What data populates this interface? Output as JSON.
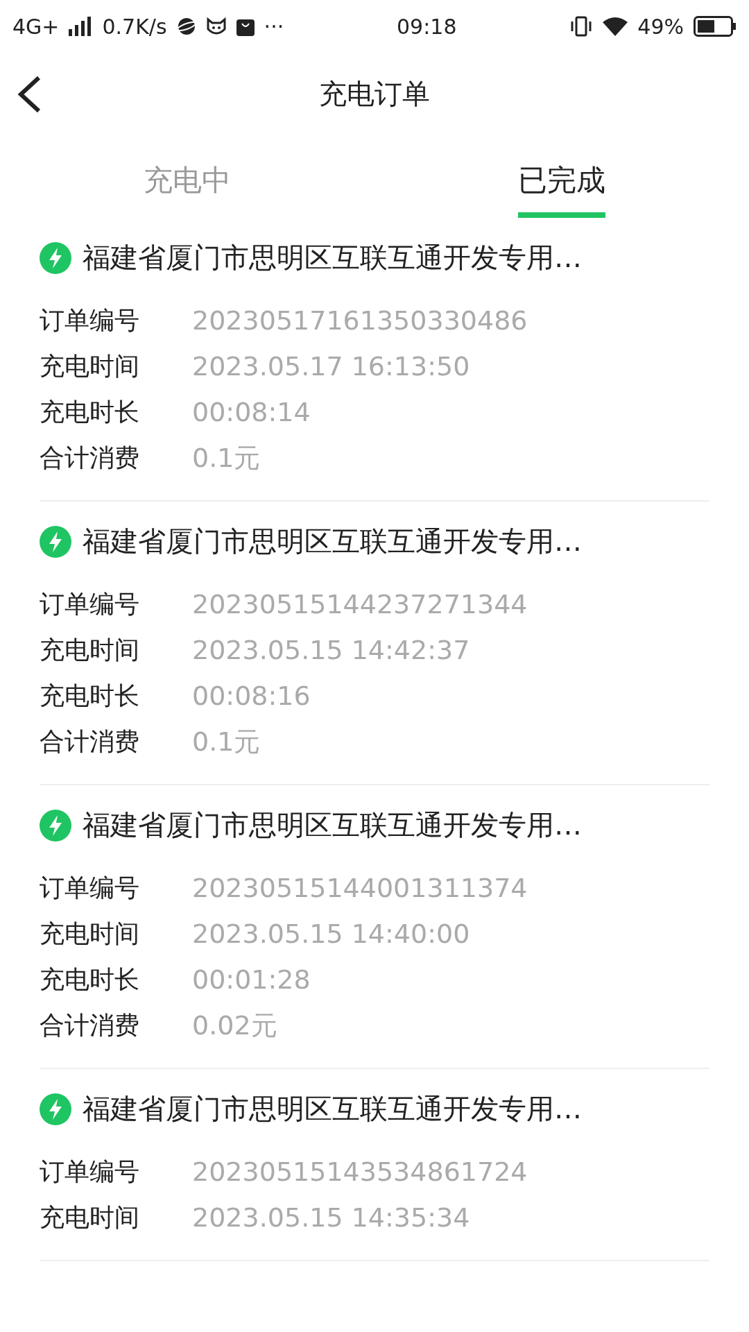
{
  "status_bar": {
    "network": "4G+",
    "speed": "0.7K/s",
    "more": "···",
    "time": "09:18",
    "battery": "49%"
  },
  "header": {
    "title": "充电订单"
  },
  "tabs": [
    {
      "label": "充电中",
      "selected": false
    },
    {
      "label": "已完成",
      "selected": true
    }
  ],
  "orders": [
    {
      "station": "福建省厦门市思明区互联互通开发专用…",
      "fields": [
        {
          "label": "订单编号",
          "value": "20230517161350330486"
        },
        {
          "label": "充电时间",
          "value": "2023.05.17 16:13:50"
        },
        {
          "label": "充电时长",
          "value": "00:08:14"
        },
        {
          "label": "合计消费",
          "value": "0.1元"
        }
      ]
    },
    {
      "station": "福建省厦门市思明区互联互通开发专用…",
      "fields": [
        {
          "label": "订单编号",
          "value": "20230515144237271344"
        },
        {
          "label": "充电时间",
          "value": "2023.05.15 14:42:37"
        },
        {
          "label": "充电时长",
          "value": "00:08:16"
        },
        {
          "label": "合计消费",
          "value": "0.1元"
        }
      ]
    },
    {
      "station": "福建省厦门市思明区互联互通开发专用…",
      "fields": [
        {
          "label": "订单编号",
          "value": "20230515144001311374"
        },
        {
          "label": "充电时间",
          "value": "2023.05.15 14:40:00"
        },
        {
          "label": "充电时长",
          "value": "00:01:28"
        },
        {
          "label": "合计消费",
          "value": "0.02元"
        }
      ]
    },
    {
      "station": "福建省厦门市思明区互联互通开发专用…",
      "fields": [
        {
          "label": "订单编号",
          "value": "20230515143534861724"
        },
        {
          "label": "充电时间",
          "value": "2023.05.15 14:35:34"
        }
      ]
    }
  ]
}
